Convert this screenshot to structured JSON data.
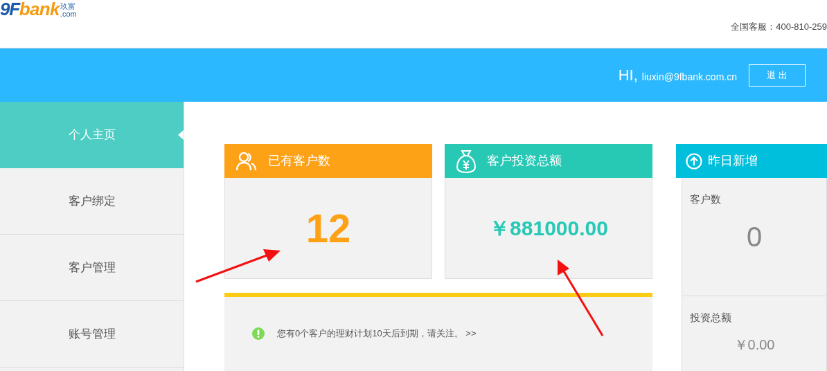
{
  "logo": {
    "brand_number": "9F",
    "brand_word": "bank",
    "chinese": "玖富",
    "domain": ".com"
  },
  "hotline": "全国客服：400-810-259",
  "user_bar": {
    "greeting": "HI,",
    "email": "liuxin@9fbank.com.cn",
    "logout": "退 出"
  },
  "sidebar": {
    "items": [
      {
        "label": "个人主页",
        "selected": true
      },
      {
        "label": "客户绑定",
        "selected": false
      },
      {
        "label": "客户管理",
        "selected": false
      },
      {
        "label": "账号管理",
        "selected": false
      }
    ]
  },
  "cards": [
    {
      "kind": "users",
      "title": "已有客户数",
      "value": "12",
      "color": "#fda116"
    },
    {
      "kind": "money",
      "title": "客户投资总额",
      "value": "￥881000.00",
      "color": "#27c9b5"
    }
  ],
  "yesterday": {
    "title": "昨日新增",
    "stats": [
      {
        "label": "客户数",
        "value": "0"
      },
      {
        "label": "投资总额",
        "value": "￥0.00"
      }
    ]
  },
  "notice": {
    "text": "您有0个客户的理财计划10天后到期，请关注。",
    "link": ">>"
  }
}
